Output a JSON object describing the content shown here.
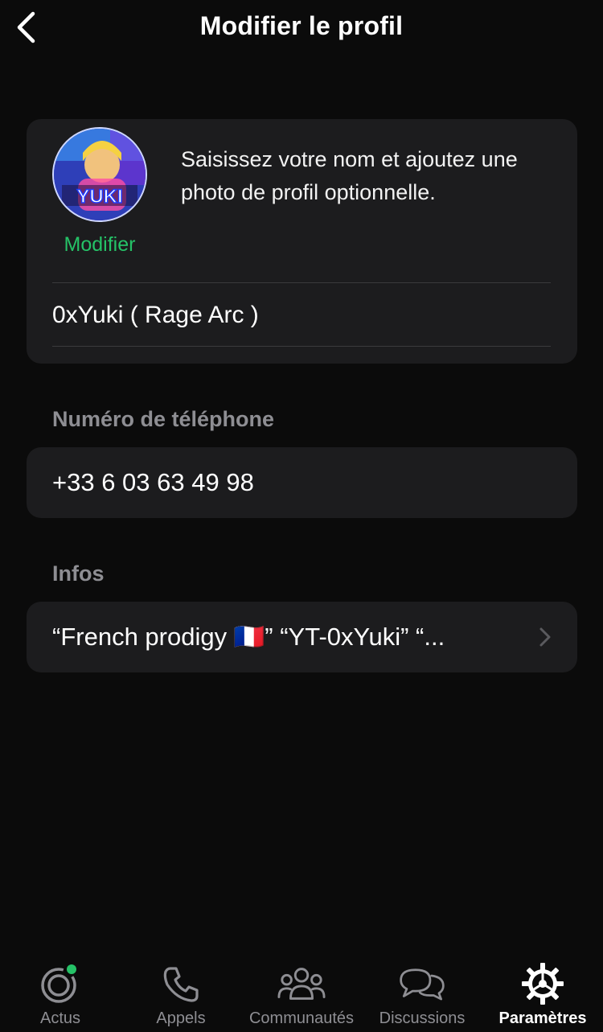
{
  "header": {
    "title": "Modifier le profil",
    "back_icon": "chevron-left-icon"
  },
  "profile": {
    "avatar_text": "YUKI",
    "edit_label": "Modifier",
    "hint": "Saisissez votre nom et ajoutez une photo de profil optionnelle.",
    "name_value": "0xYuki ( Rage Arc )"
  },
  "phone": {
    "section_label": "Numéro de téléphone",
    "value": "+33 6 03 63 49 98"
  },
  "about": {
    "section_label": "Infos",
    "value": "“French prodigy 🇫🇷” “YT-0xYuki” “...",
    "chevron_icon": "chevron-right-icon"
  },
  "tabbar": {
    "tabs": [
      {
        "label": "Actus",
        "icon": "updates-icon",
        "active": false,
        "has_dot": true
      },
      {
        "label": "Appels",
        "icon": "phone-icon",
        "active": false
      },
      {
        "label": "Communautés",
        "icon": "communities-icon",
        "active": false
      },
      {
        "label": "Discussions",
        "icon": "chats-icon",
        "active": false
      },
      {
        "label": "Paramètres",
        "icon": "settings-icon",
        "active": true
      }
    ]
  },
  "colors": {
    "background": "#0b0b0b",
    "card": "#1c1c1e",
    "accent_green": "#25c267",
    "secondary_text": "#8e8e93"
  }
}
